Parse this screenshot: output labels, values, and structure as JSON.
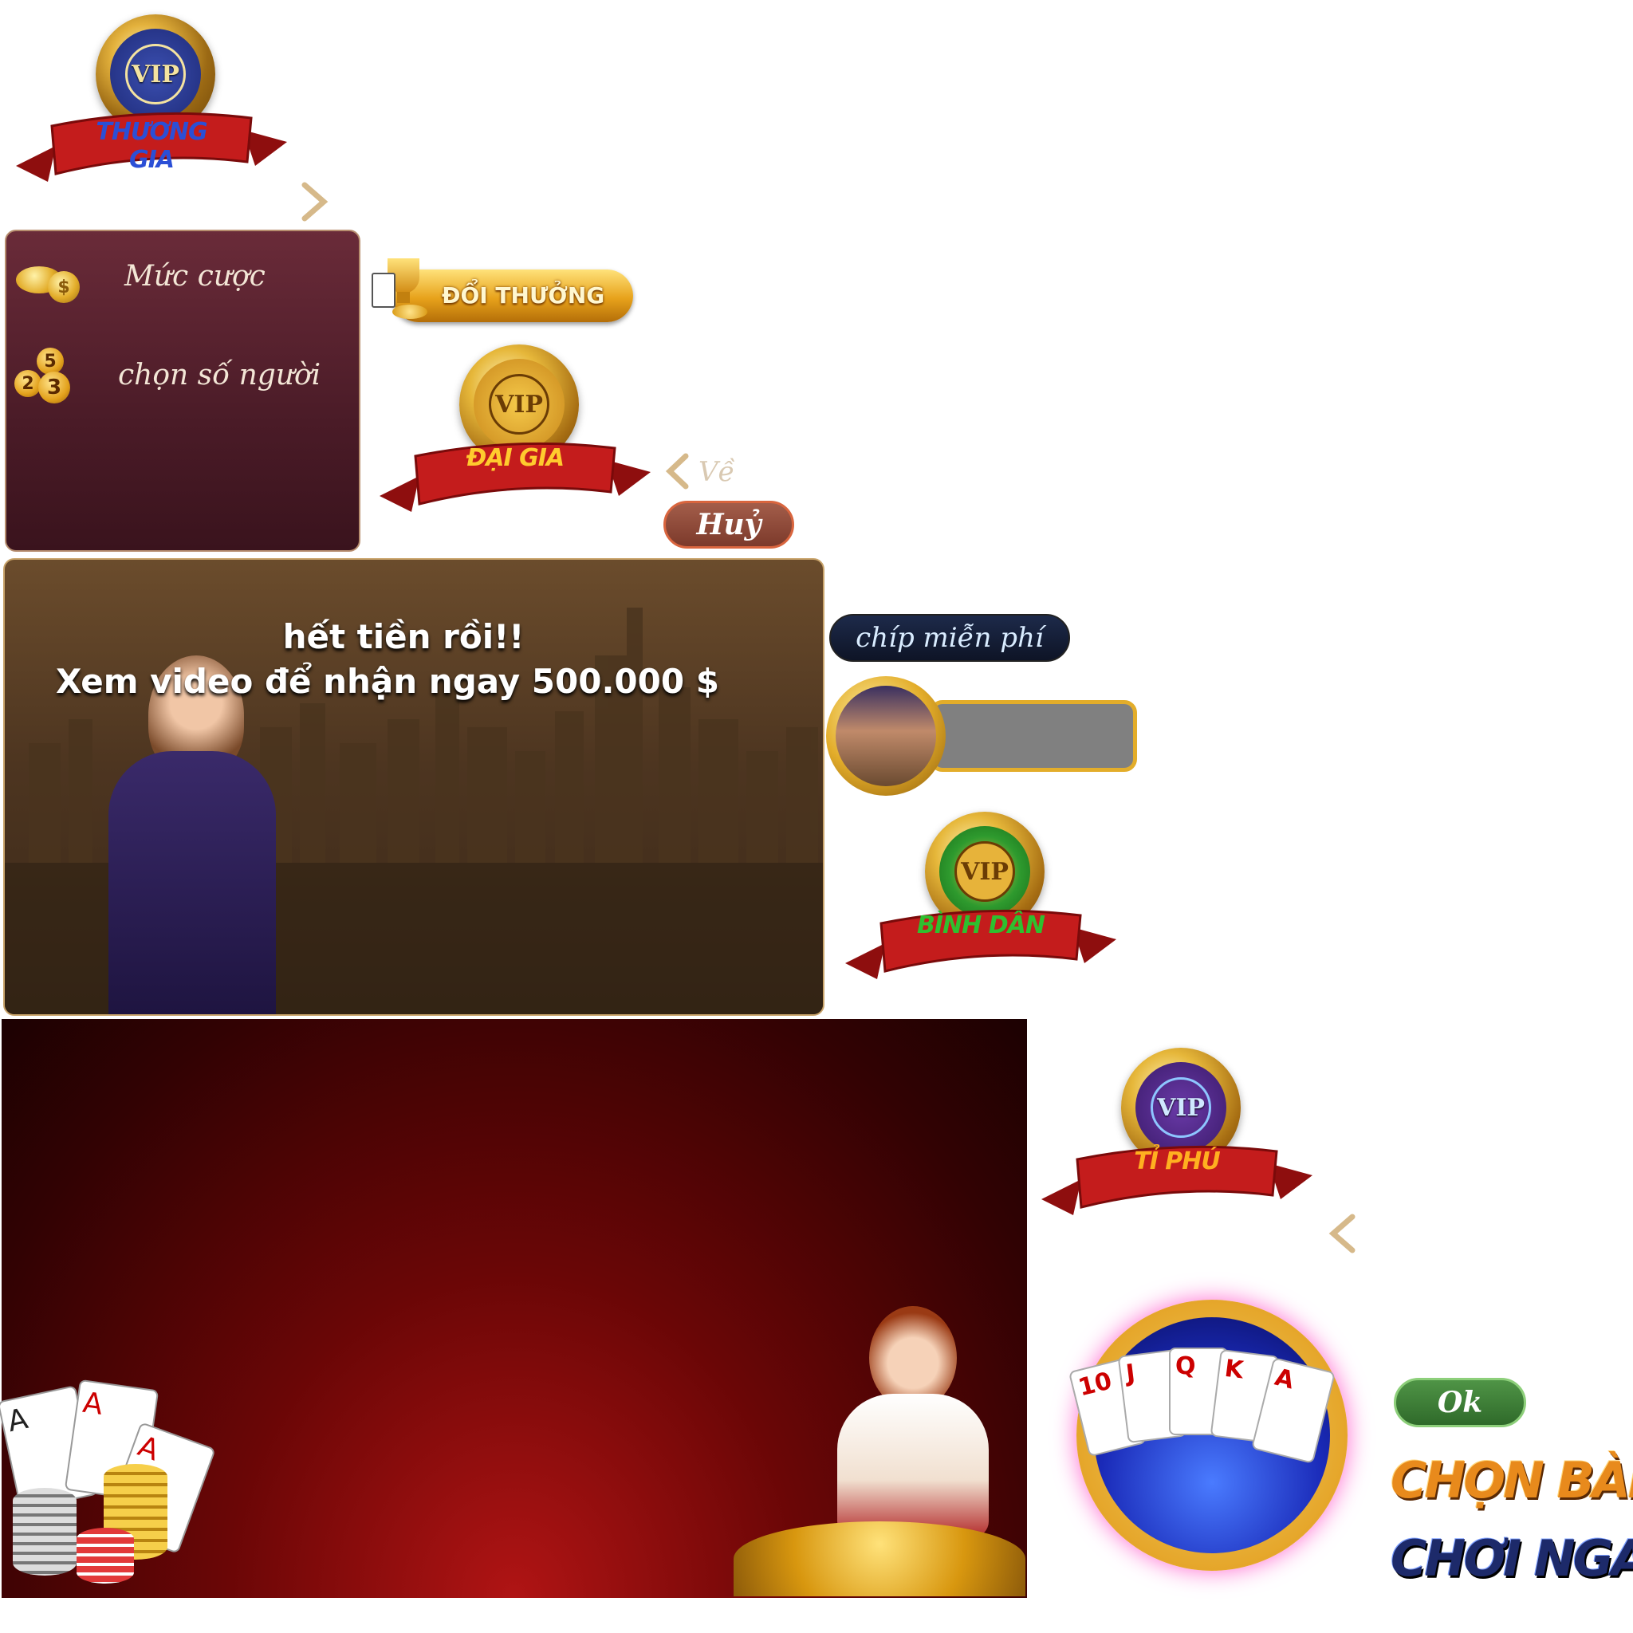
{
  "badges": {
    "thuong_gia": "THƯƠNG GIA",
    "dai_gia": "ĐẠI GIA",
    "binh_dan": "BÌNH DÂN",
    "ti_phu": "TỈ PHÚ",
    "vip": "VIP"
  },
  "settings_panel": {
    "bet_label": "Mức cược",
    "players_label": "chọn số người",
    "player_numbers": [
      "5",
      "2",
      "3"
    ]
  },
  "buttons": {
    "reward": "ĐỔI THƯỞNG",
    "back": "Về",
    "cancel": "Huỷ",
    "free_chip": "chíp miễn phí",
    "ok": "Ok"
  },
  "banner": {
    "line1": "hết tiền rồi!!",
    "line2": "Xem video để nhận ngay 500.000 $"
  },
  "cards": [
    "10",
    "J",
    "Q",
    "K",
    "A"
  ],
  "logo": {
    "line1": "CHỌN BÀN",
    "line2": "CHƠI NGAY"
  },
  "colors": {
    "panel": "#4a1b27",
    "cancel": "#8b4a3a",
    "ok": "#3e7a36",
    "gold": "#e6b73a"
  }
}
